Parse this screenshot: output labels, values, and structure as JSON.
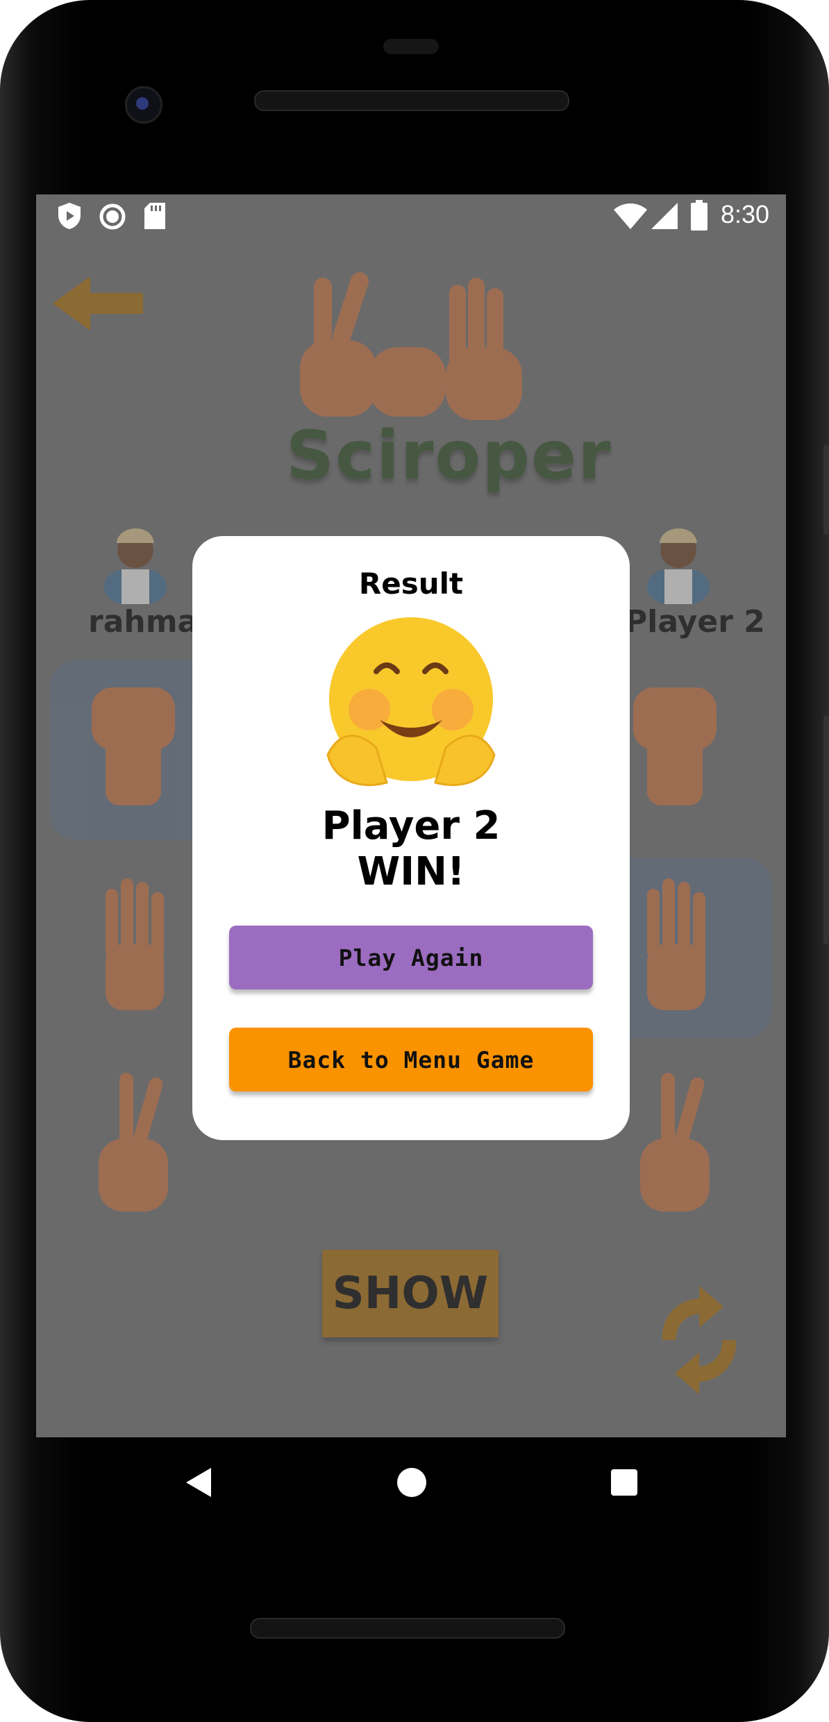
{
  "status_bar": {
    "time": "8:30",
    "left_icons": [
      "shield-play-icon",
      "record-circle-icon",
      "sd-card-icon"
    ],
    "right_icons": [
      "wifi-icon",
      "cellular-signal-icon",
      "battery-icon"
    ]
  },
  "game": {
    "title": "Sciroper",
    "player1_name": "rahmat",
    "player2_name": "Player 2",
    "show_button": "SHOW",
    "choices": [
      "rock",
      "paper",
      "scissors"
    ]
  },
  "dialog": {
    "heading": "Result",
    "emoji": "hugging-face",
    "result_line1": "Player 2",
    "result_line2": "WIN!",
    "play_again_label": "Play Again",
    "back_label": "Back to Menu Game"
  },
  "colors": {
    "dim_background": "#6a6a6a",
    "title_green": "#2c4a22",
    "play_again_button": "#9b6cc0",
    "back_button": "#fb9300",
    "selected_card": "#5e6d80",
    "accent_orange": "#a86a08"
  },
  "nav_bar": {
    "buttons": [
      "back-triangle-icon",
      "home-circle-icon",
      "recents-square-icon"
    ]
  }
}
